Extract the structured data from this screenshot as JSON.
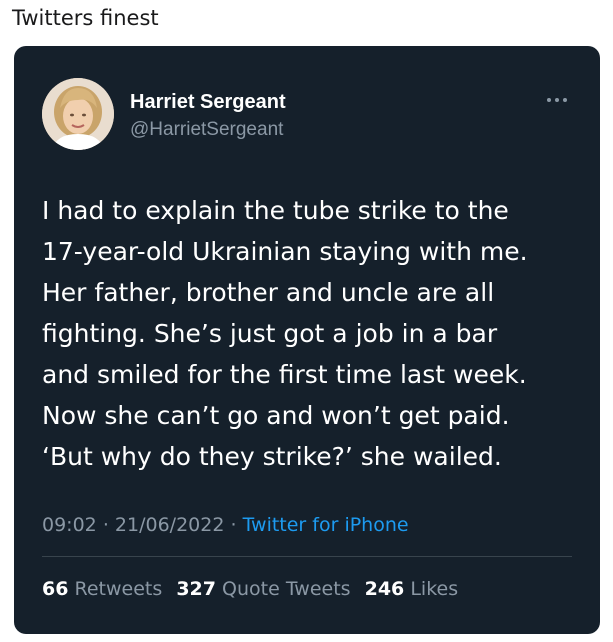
{
  "post": {
    "title": "Twitters finest"
  },
  "tweet": {
    "display_name": "Harriet Sergeant",
    "handle": "@HarrietSergeant",
    "text": "I had to explain the tube strike to the\n17-year-old Ukrainian staying with me.\nHer father, brother and uncle are all\nfighting. She’s just got a job in a bar\nand smiled for the first time last week.\nNow she can’t go and won’t get paid.\n‘But why do they strike?’ she wailed.",
    "time": "09:02",
    "date": "21/06/2022",
    "separator": "·",
    "source": "Twitter for iPhone",
    "stats": {
      "retweets_count": "66",
      "retweets_label": "Retweets",
      "quotes_count": "327",
      "quotes_label": "Quote Tweets",
      "likes_count": "246",
      "likes_label": "Likes"
    }
  },
  "icons": {
    "more": "more-horizontal-icon",
    "avatar": "profile-photo"
  },
  "colors": {
    "card_background": "#15202b",
    "text_primary": "#ffffff",
    "text_secondary": "#8b98a5",
    "link": "#1d9bf0",
    "divider": "#38444d"
  }
}
